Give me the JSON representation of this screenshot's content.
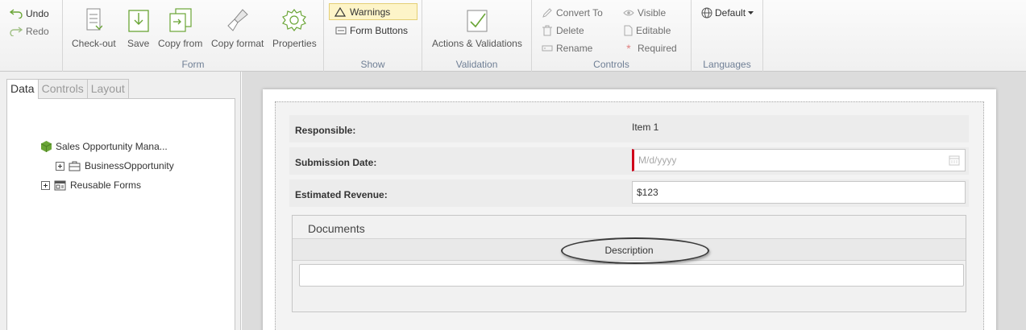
{
  "ribbon": {
    "undo": "Undo",
    "redo": "Redo",
    "form_group": {
      "caption": "Form",
      "checkout": "Check-out",
      "save": "Save",
      "copy_from": "Copy from",
      "copy_format": "Copy format",
      "properties": "Properties"
    },
    "show_group": {
      "caption": "Show",
      "warnings": "Warnings",
      "form_buttons": "Form Buttons"
    },
    "validation_group": {
      "caption": "Validation",
      "actions": "Actions & Validations"
    },
    "controls_group": {
      "caption": "Controls",
      "convert_to": "Convert To",
      "delete": "Delete",
      "rename": "Rename",
      "visible": "Visible",
      "editable": "Editable",
      "required": "Required"
    },
    "languages_group": {
      "caption": "Languages",
      "default": "Default"
    }
  },
  "left_panel": {
    "tabs": [
      "Data",
      "Controls",
      "Layout"
    ],
    "active_tab": "Data",
    "tree": [
      {
        "label": "Sales Opportunity Mana...",
        "icon": "cube-icon"
      },
      {
        "label": "BusinessOpportunity",
        "icon": "briefcase-icon"
      },
      {
        "label": "Reusable Forms",
        "icon": "forms-icon"
      }
    ]
  },
  "form": {
    "fields": [
      {
        "label": "Responsible:",
        "value": "Item 1"
      },
      {
        "label": "Submission Date:",
        "placeholder": "M/d/yyyy",
        "required": true
      },
      {
        "label": "Estimated Revenue:",
        "value": "$123"
      }
    ],
    "documents": {
      "title": "Documents",
      "column": "Description"
    }
  },
  "colors": {
    "required_marker": "#d0021b",
    "warnings_highlight": "#fdf4c8",
    "icon_green": "#6aa536",
    "caption_text": "#6f7f95"
  }
}
